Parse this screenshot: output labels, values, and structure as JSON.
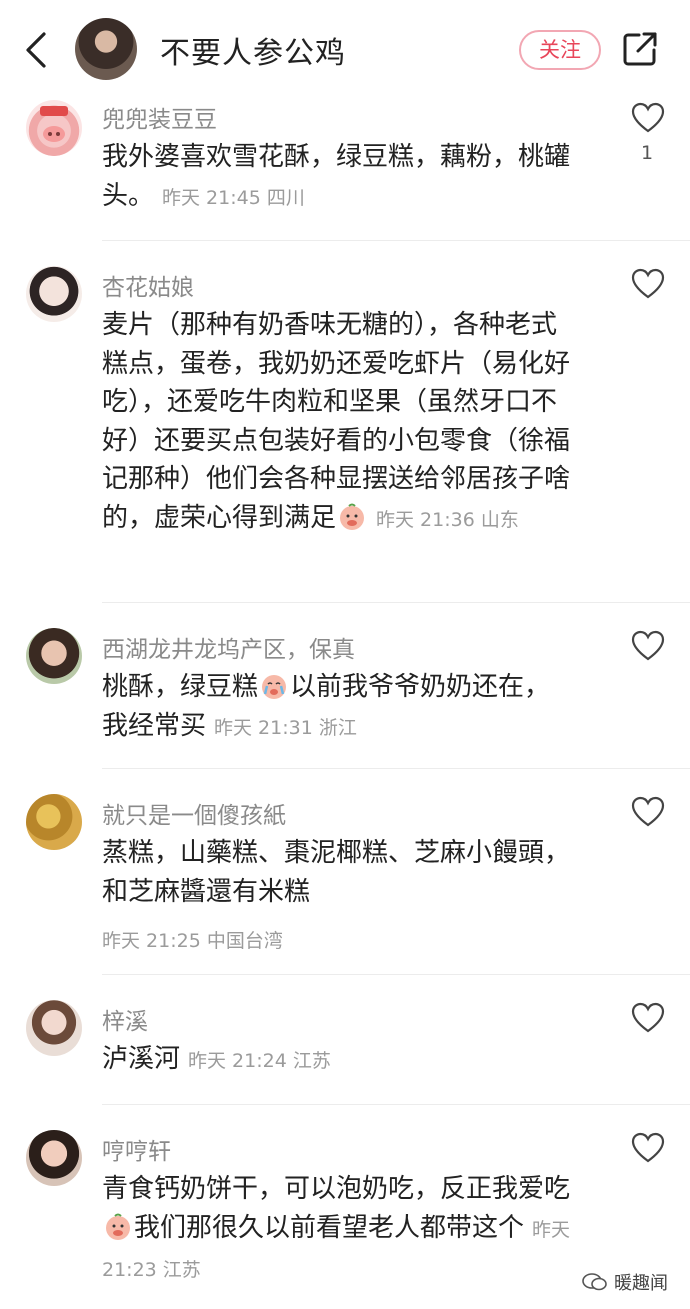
{
  "header": {
    "title": "不要人参公鸡",
    "follow_label": "关注",
    "icons": {
      "back": "back-chevron-icon",
      "share": "share-icon"
    }
  },
  "comments": [
    {
      "username": "兜兜装豆豆",
      "text": "我外婆喜欢雪花酥，绿豆糕，藕粉，桃罐头。",
      "meta": "昨天 21:45 四川",
      "likes": "1"
    },
    {
      "username": "杏花姑娘",
      "text": "麦片（那种有奶香味无糖的），各种老式糕点，蛋卷，我奶奶还爱吃虾片（易化好吃），还爱吃牛肉粒和坚果（虽然牙口不好）还要买点包装好看的小包零食（徐福记那种）他们会各种显摆送给邻居孩子啥的，虚荣心得到满足",
      "meta": "昨天 21:36 山东",
      "likes": ""
    },
    {
      "username": "西湖龙井龙坞产区，保真",
      "text_a": "桃酥，绿豆糕",
      "text_b": "以前我爷爷奶奶还在，我经常买",
      "meta": "昨天 21:31 浙江",
      "likes": ""
    },
    {
      "username": "就只是一個傻孩紙",
      "text": "蒸糕，山藥糕、棗泥椰糕、芝麻小饅頭，和芝麻醬還有米糕",
      "meta": "昨天 21:25 中国台湾",
      "likes": ""
    },
    {
      "username": "梓溪",
      "text": "泸溪河",
      "meta": "昨天 21:24 江苏",
      "likes": ""
    },
    {
      "username": "哼哼轩",
      "text_a": "青食钙奶饼干，可以泡奶吃，反正我爱吃",
      "text_b": "我们那很久以前看望老人都带这个",
      "meta": "昨天 21:23 江苏",
      "likes": ""
    }
  ],
  "watermark": {
    "text": "暖趣闻"
  },
  "colors": {
    "accent": "#e8465a",
    "follow_border": "#f2a7b3",
    "muted": "#9b9b9b"
  }
}
